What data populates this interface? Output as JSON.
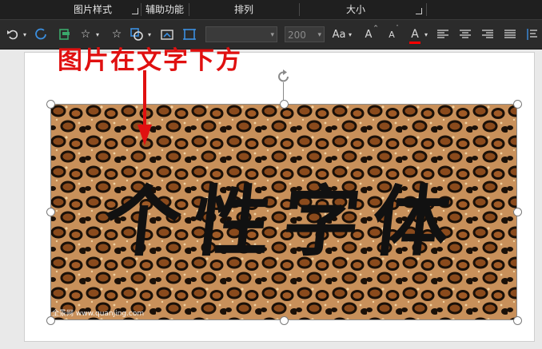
{
  "ribbon": {
    "groups": {
      "picture_style": "图片样式",
      "accessibility": "辅助功能",
      "arrange": "排列",
      "size": "大小"
    },
    "font_size_value": "200",
    "font_case_label": "Aa",
    "grow_font_label": "A",
    "shrink_font_label": "A",
    "font_color_label": "A",
    "font_color": "#ff0000"
  },
  "slide": {
    "annotation_text": "图片在文字下方",
    "annotation_color": "#e01010",
    "picture_text": "个性字体",
    "watermark": "全景网 www.quanjing.com"
  }
}
